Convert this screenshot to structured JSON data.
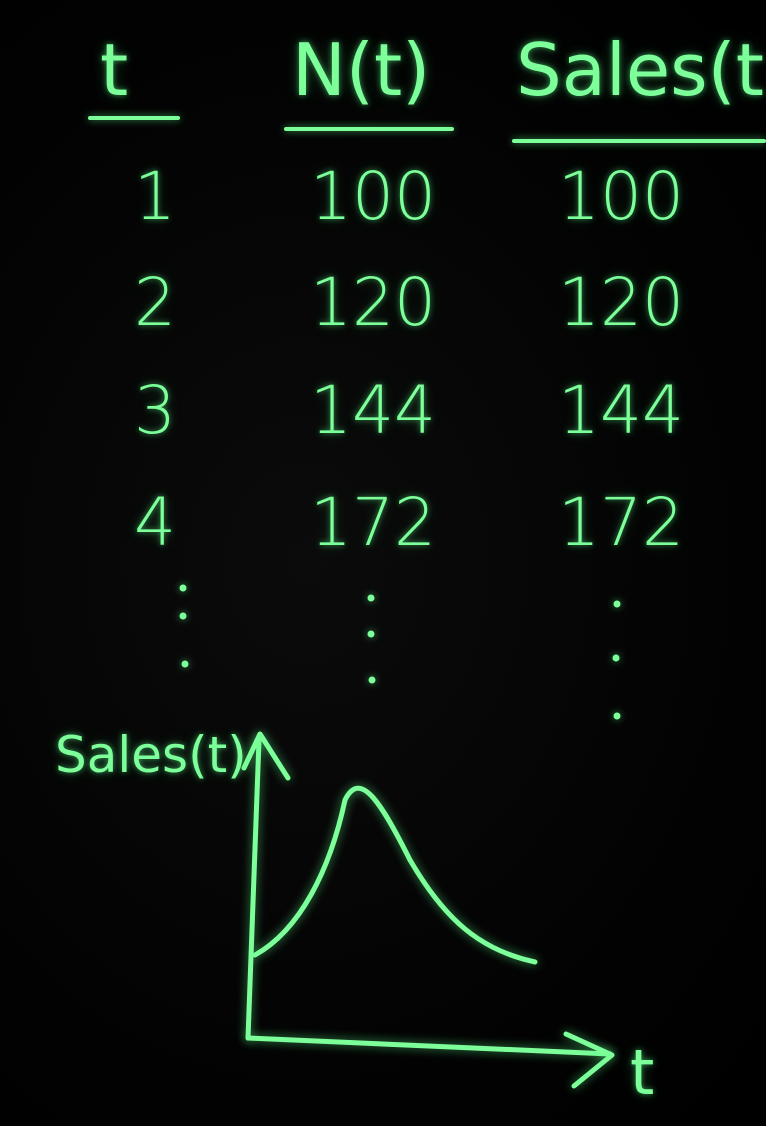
{
  "table": {
    "headers": [
      "t",
      "N(t)",
      "Sales(t"
    ],
    "rows": [
      {
        "t": "1",
        "n": "100",
        "sales": "100"
      },
      {
        "t": "2",
        "n": "120",
        "sales": "120"
      },
      {
        "t": "3",
        "n": "144",
        "sales": "144"
      },
      {
        "t": "4",
        "n": "172",
        "sales": "172"
      }
    ]
  },
  "graph": {
    "y_axis_label": "Sales(t)",
    "x_axis_label": "t"
  },
  "colors": {
    "chalk": "#7dff9a",
    "board": "#000000"
  }
}
